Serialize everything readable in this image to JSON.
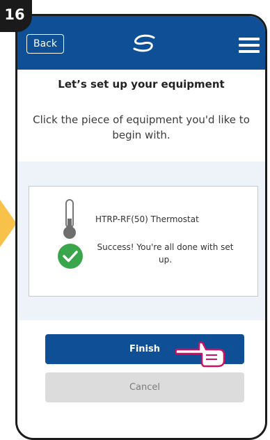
{
  "step": {
    "number": "16"
  },
  "header": {
    "back_label": "Back",
    "logo_icon": "salus-swirl-logo",
    "menu_icon": "hamburger-menu-icon",
    "color": "#0f4f96"
  },
  "page": {
    "title": "Let’s set up your equipment",
    "instruction": "Click the piece of equipment you'd like to begin with."
  },
  "equipment": {
    "name": "HTRP-RF(50) Thermostat",
    "status_text": "Success! You're all done with set up.",
    "thermometer_icon": "thermometer-icon",
    "check_icon": "check-circle-icon",
    "success_color": "#3aa64b"
  },
  "actions": {
    "finish_label": "Finish",
    "cancel_label": "Cancel"
  },
  "annotation": {
    "pointer_icon": "hand-pointer-icon",
    "pointer_color": "#d0105e",
    "arrow_color": "#f7c14a"
  }
}
